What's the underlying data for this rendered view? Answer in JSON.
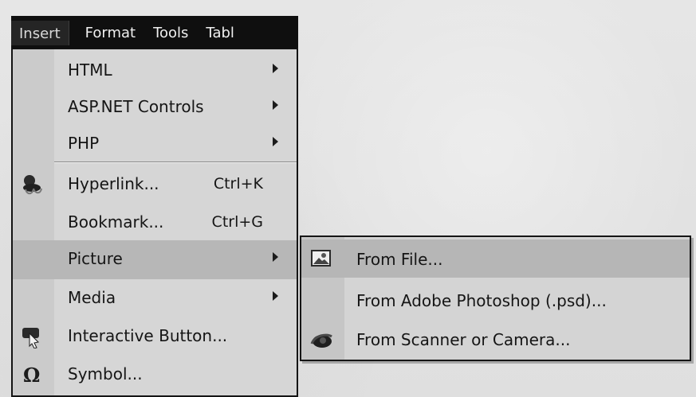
{
  "menubar": {
    "items": [
      {
        "label": "Insert"
      },
      {
        "label": "Format"
      },
      {
        "label": "Tools"
      },
      {
        "label": "Tabl"
      }
    ]
  },
  "insert_menu": {
    "items": [
      {
        "label": "HTML",
        "shortcut": "",
        "submenu": true,
        "icon": ""
      },
      {
        "label": "ASP.NET Controls",
        "shortcut": "",
        "submenu": true,
        "icon": ""
      },
      {
        "label": "PHP",
        "shortcut": "",
        "submenu": true,
        "icon": ""
      },
      {
        "label": "Hyperlink...",
        "shortcut": "Ctrl+K",
        "submenu": false,
        "icon": "hyperlink-icon"
      },
      {
        "label": "Bookmark...",
        "shortcut": "Ctrl+G",
        "submenu": false,
        "icon": ""
      },
      {
        "label": "Picture",
        "shortcut": "",
        "submenu": true,
        "icon": "",
        "selected": true
      },
      {
        "label": "Media",
        "shortcut": "",
        "submenu": true,
        "icon": ""
      },
      {
        "label": "Interactive Button...",
        "shortcut": "",
        "submenu": false,
        "icon": "interactive-button-icon"
      },
      {
        "label": "Symbol...",
        "shortcut": "",
        "submenu": false,
        "icon": "omega-icon"
      }
    ]
  },
  "picture_submenu": {
    "items": [
      {
        "label": "From File...",
        "icon": "picture-file-icon",
        "selected": true
      },
      {
        "label": "From Adobe Photoshop (.psd)...",
        "icon": ""
      },
      {
        "label": "From Scanner or Camera...",
        "icon": "scanner-camera-icon"
      }
    ]
  },
  "colors": {
    "menubar_background": "#0f0f0f",
    "menu_background": "#d6d6d6",
    "selected_background": "#b7b7b7"
  }
}
